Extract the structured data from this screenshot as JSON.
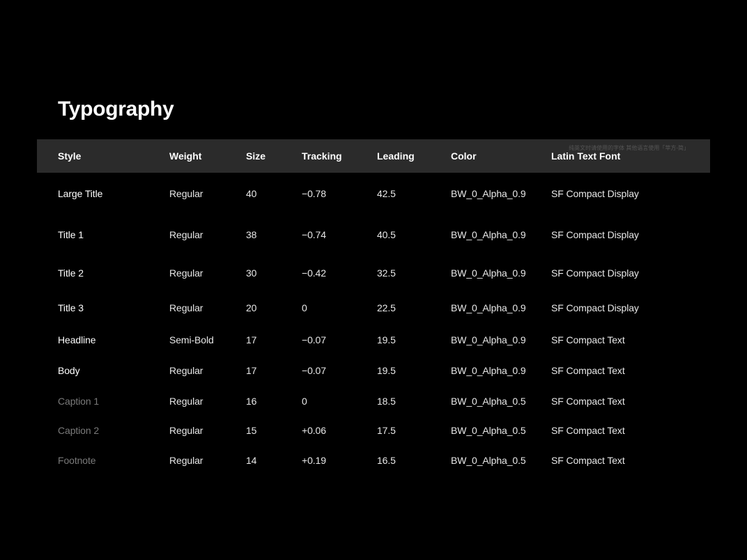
{
  "title": "Typography",
  "header_note": "纯英文时请使用的字体\n其他语言使用「苹方-简」",
  "columns": {
    "style": "Style",
    "weight": "Weight",
    "size": "Size",
    "tracking": "Tracking",
    "leading": "Leading",
    "color": "Color",
    "font": "Latin Text Font"
  },
  "rows": [
    {
      "style": "Large Title",
      "style_class": "style-large-title",
      "weight": "Regular",
      "size": "40",
      "tracking": "−0.78",
      "leading": "42.5",
      "color": "BW_0_Alpha_0.9",
      "font": "SF Compact Display"
    },
    {
      "style": "Title 1",
      "style_class": "style-title1",
      "weight": "Regular",
      "size": "38",
      "tracking": "−0.74",
      "leading": "40.5",
      "color": "BW_0_Alpha_0.9",
      "font": "SF Compact Display"
    },
    {
      "style": "Title 2",
      "style_class": "style-title2",
      "weight": "Regular",
      "size": "30",
      "tracking": "−0.42",
      "leading": "32.5",
      "color": "BW_0_Alpha_0.9",
      "font": "SF Compact Display"
    },
    {
      "style": "Title 3",
      "style_class": "style-title3",
      "weight": "Regular",
      "size": "20",
      "tracking": "0",
      "leading": "22.5",
      "color": "BW_0_Alpha_0.9",
      "font": "SF Compact Display"
    },
    {
      "style": "Headline",
      "style_class": "style-headline",
      "weight": "Semi-Bold",
      "size": "17",
      "tracking": "−0.07",
      "leading": "19.5",
      "color": "BW_0_Alpha_0.9",
      "font": "SF Compact Text"
    },
    {
      "style": "Body",
      "style_class": "style-body",
      "weight": "Regular",
      "size": "17",
      "tracking": "−0.07",
      "leading": "19.5",
      "color": "BW_0_Alpha_0.9",
      "font": "SF Compact Text"
    },
    {
      "style": "Caption 1",
      "style_class": "style-caption1",
      "weight": "Regular",
      "size": "16",
      "tracking": "0",
      "leading": "18.5",
      "color": "BW_0_Alpha_0.5",
      "font": "SF Compact Text"
    },
    {
      "style": "Caption 2",
      "style_class": "style-caption2",
      "weight": "Regular",
      "size": "15",
      "tracking": "+0.06",
      "leading": "17.5",
      "color": "BW_0_Alpha_0.5",
      "font": "SF Compact Text"
    },
    {
      "style": "Footnote",
      "style_class": "style-footnote",
      "weight": "Regular",
      "size": "14",
      "tracking": "+0.19",
      "leading": "16.5",
      "color": "BW_0_Alpha_0.5",
      "font": "SF Compact Text"
    }
  ]
}
